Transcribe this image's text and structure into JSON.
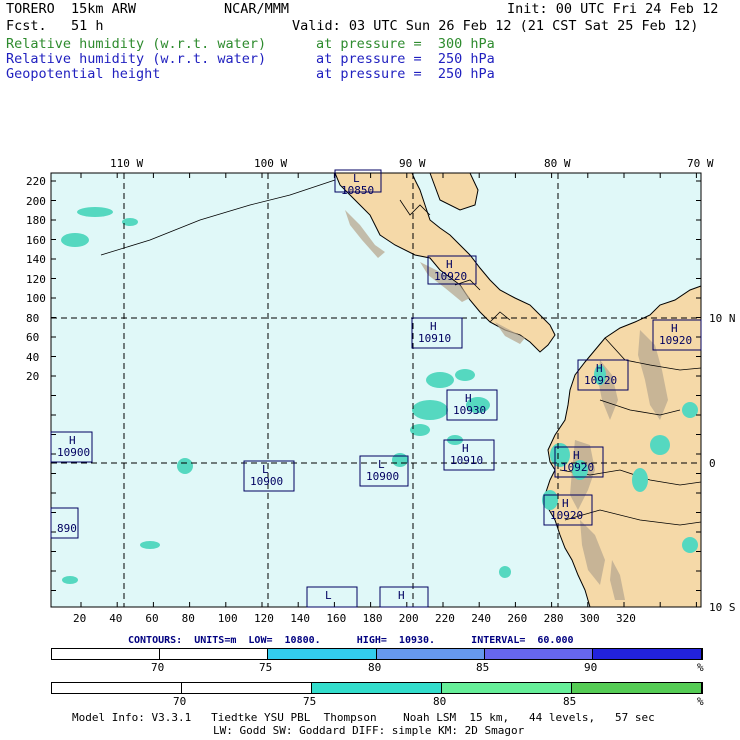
{
  "header": {
    "model_name": "TORERO  15km ARW",
    "center": "NCAR/MMM",
    "init": "Init: 00 UTC Fri 24 Feb 12",
    "fcst": "Fcst.   51 h",
    "valid": "Valid: 03 UTC Sun 26 Feb 12 (21 CST Sat 25 Feb 12)"
  },
  "fields": [
    {
      "name": "Relative humidity (w.r.t. water)",
      "pressure": "at pressure =  300 hPa",
      "color": "#2e8b2e"
    },
    {
      "name": "Relative humidity (w.r.t. water)",
      "pressure": "at pressure =  250 hPa",
      "color": "#1f1fbf"
    },
    {
      "name": "Geopotential height",
      "pressure": "at pressure =  250 hPa",
      "color": "#1f1fbf"
    }
  ],
  "axes": {
    "top_lon": [
      "110 W",
      "100 W",
      "90 W",
      "80 W",
      "70 W"
    ],
    "right_lat": [
      "10 N",
      "0",
      "10 S"
    ],
    "left_y": [
      "220",
      "200",
      "180",
      "160",
      "140",
      "120",
      "100",
      "80",
      "60",
      "40",
      "20"
    ],
    "bottom_x": [
      "20",
      "40",
      "60",
      "80",
      "100",
      "120",
      "140",
      "160",
      "180",
      "200",
      "220",
      "240",
      "260",
      "280",
      "300",
      "320"
    ]
  },
  "height_centers": [
    {
      "type": "L",
      "value": "10850"
    },
    {
      "type": "H",
      "value": "10920"
    },
    {
      "type": "H",
      "value": "10910"
    },
    {
      "type": "H",
      "value": "10920"
    },
    {
      "type": "H",
      "value": "10920"
    },
    {
      "type": "H",
      "value": "10930"
    },
    {
      "type": "H",
      "value": "10900"
    },
    {
      "type": "H",
      "value": "10910"
    },
    {
      "type": "L",
      "value": "10900"
    },
    {
      "type": "L",
      "value": "10900"
    },
    {
      "type": "H",
      "value": "10920"
    },
    {
      "type": "H",
      "value": "10920"
    },
    {
      "type": "",
      "value": "890"
    },
    {
      "type": "L",
      "value": ""
    },
    {
      "type": "H",
      "value": ""
    }
  ],
  "contours": {
    "text": "CONTOURS:  UNITS=m  LOW=  10800.      HIGH=  10930.      INTERVAL=  60.000"
  },
  "colorbar_250": {
    "labels": [
      "70",
      "75",
      "80",
      "85",
      "90",
      "%"
    ],
    "colors": [
      "#ffffff",
      "#ffffff",
      "#33ccee",
      "#6699ee",
      "#6666ee",
      "#2222dd"
    ]
  },
  "colorbar_300": {
    "labels": [
      "70",
      "75",
      "80",
      "85",
      "%"
    ],
    "colors": [
      "#ffffff",
      "#ffffff",
      "#33ddcc",
      "#66ee99",
      "#55cc55"
    ]
  },
  "model_info": {
    "line1": "Model Info: V3.3.1   Tiedtke YSU PBL  Thompson    Noah LSM  15 km,   44 levels,   57 sec",
    "line2": "LW: Godd SW: Goddard DIFF: simple KM: 2D Smagor"
  },
  "colors": {
    "ocean": "#e0f8f8",
    "land": "#f5d9a8",
    "mountain": "#b8a890",
    "humidity_patch": "#55d8c0"
  }
}
